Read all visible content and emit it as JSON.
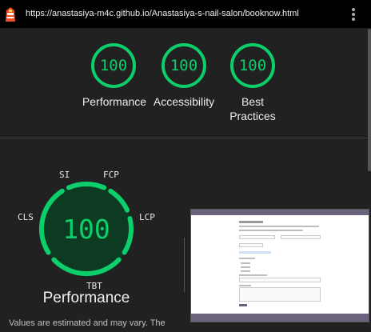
{
  "browser": {
    "url": "https://anastasiya-m4c.github.io/Anastasiya-s-nail-salon/booknow.html"
  },
  "summary_scores": [
    {
      "value": "100",
      "label": "Performance"
    },
    {
      "value": "100",
      "label": "Accessibility"
    },
    {
      "value": "100",
      "label": "Best Practices",
      "label_line1": "Best",
      "label_line2": "Practices"
    }
  ],
  "performance": {
    "score": "100",
    "title": "Performance",
    "metrics": {
      "si": "SI",
      "fcp": "FCP",
      "cls": "CLS",
      "lcp": "LCP",
      "tbt": "TBT"
    },
    "note": "Values are estimated and may vary. The"
  },
  "colors": {
    "pass": "#0cce6b",
    "pass_bg": "#0c3b22",
    "background": "#212121"
  }
}
